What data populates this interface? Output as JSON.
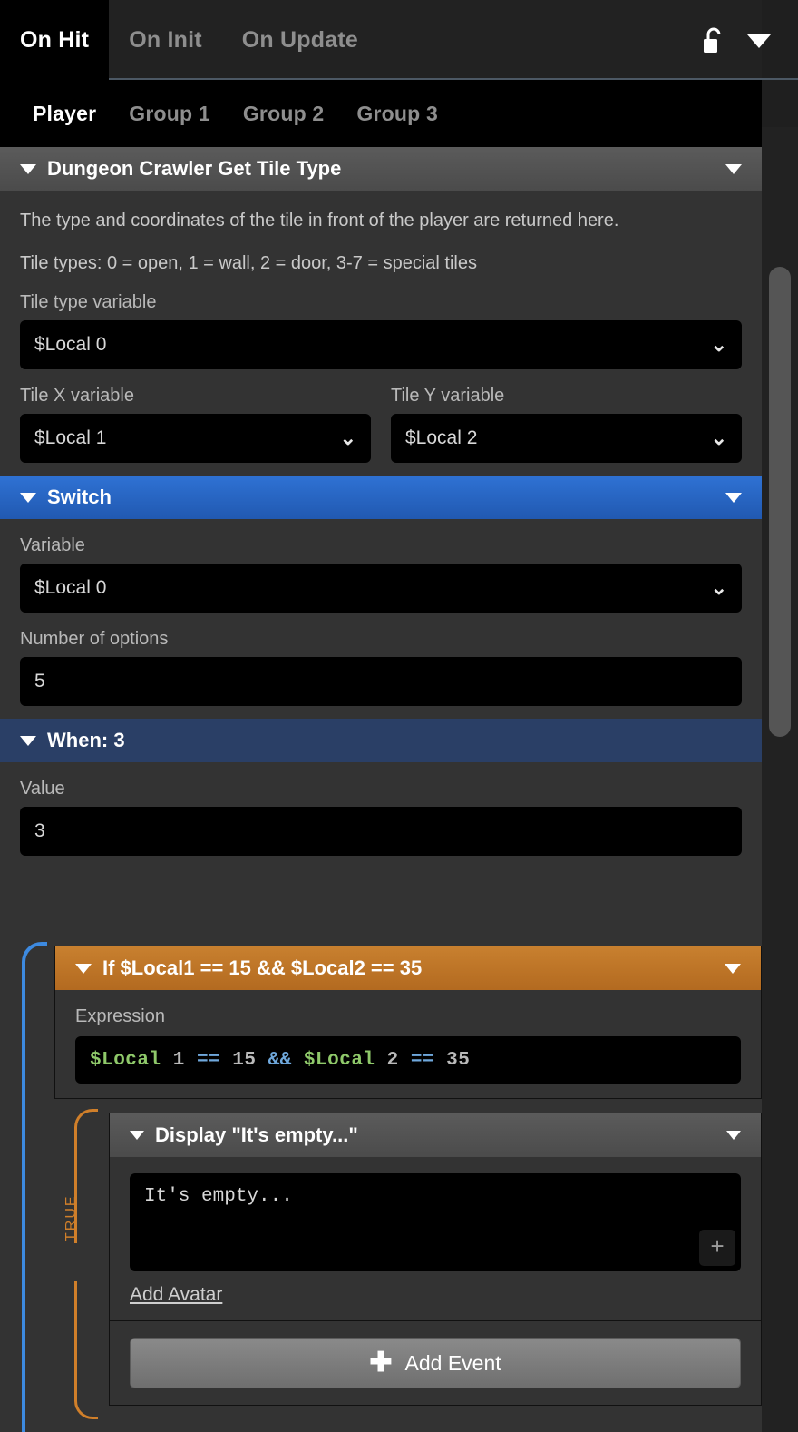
{
  "event_tabs": [
    {
      "label": "On Hit",
      "active": true
    },
    {
      "label": "On Init",
      "active": false
    },
    {
      "label": "On Update",
      "active": false
    }
  ],
  "header_icons": {
    "lock": "unlock-icon",
    "caret": "chevron-down-icon"
  },
  "group_tabs": [
    {
      "label": "Player",
      "active": true
    },
    {
      "label": "Group 1",
      "active": false
    },
    {
      "label": "Group 2",
      "active": false
    },
    {
      "label": "Group 3",
      "active": false
    }
  ],
  "tile_type_block": {
    "title": "Dungeon Crawler Get Tile Type",
    "description_1": "The type and coordinates of the tile in front of the player are returned here.",
    "description_2": "Tile types: 0 = open, 1 = wall, 2 = door, 3-7 = special tiles",
    "tile_type_label": "Tile type variable",
    "tile_type_value": "$Local 0",
    "tile_x_label": "Tile X variable",
    "tile_x_value": "$Local 1",
    "tile_y_label": "Tile Y variable",
    "tile_y_value": "$Local 2"
  },
  "switch_block": {
    "title": "Switch",
    "variable_label": "Variable",
    "variable_value": "$Local 0",
    "options_label": "Number of options",
    "options_value": "5"
  },
  "when_block": {
    "title": "When: 3",
    "value_label": "Value",
    "value": "3"
  },
  "if_block": {
    "title": "If $Local1 == 15 && $Local2 == 35",
    "expression_label": "Expression",
    "expression_tokens": [
      {
        "text": "$Local",
        "kind": "var"
      },
      {
        "text": " 1 ",
        "kind": "plain"
      },
      {
        "text": "==",
        "kind": "op"
      },
      {
        "text": " 15 ",
        "kind": "num"
      },
      {
        "text": "&&",
        "kind": "op"
      },
      {
        "text": " ",
        "kind": "plain"
      },
      {
        "text": "$Local",
        "kind": "var"
      },
      {
        "text": " 2 ",
        "kind": "plain"
      },
      {
        "text": "==",
        "kind": "op"
      },
      {
        "text": " 35",
        "kind": "num"
      }
    ],
    "branch_label": "TRUE"
  },
  "display_block": {
    "title": "Display \"It's empty...\"",
    "message": "It's empty...",
    "resize_icon": "plus-icon",
    "add_avatar_label": "Add Avatar"
  },
  "add_event": {
    "label": "Add Event",
    "icon": "plus-icon"
  },
  "colors": {
    "accent_blue": "#2f72d4",
    "navy": "#2a3f66",
    "orange": "#c8802f",
    "nest_blue": "#3d8ae0",
    "nest_orange": "#d07f2a",
    "syntax_var": "#8fc96a",
    "syntax_op": "#6fa8dc",
    "syntax_num": "#b9b9b9"
  }
}
